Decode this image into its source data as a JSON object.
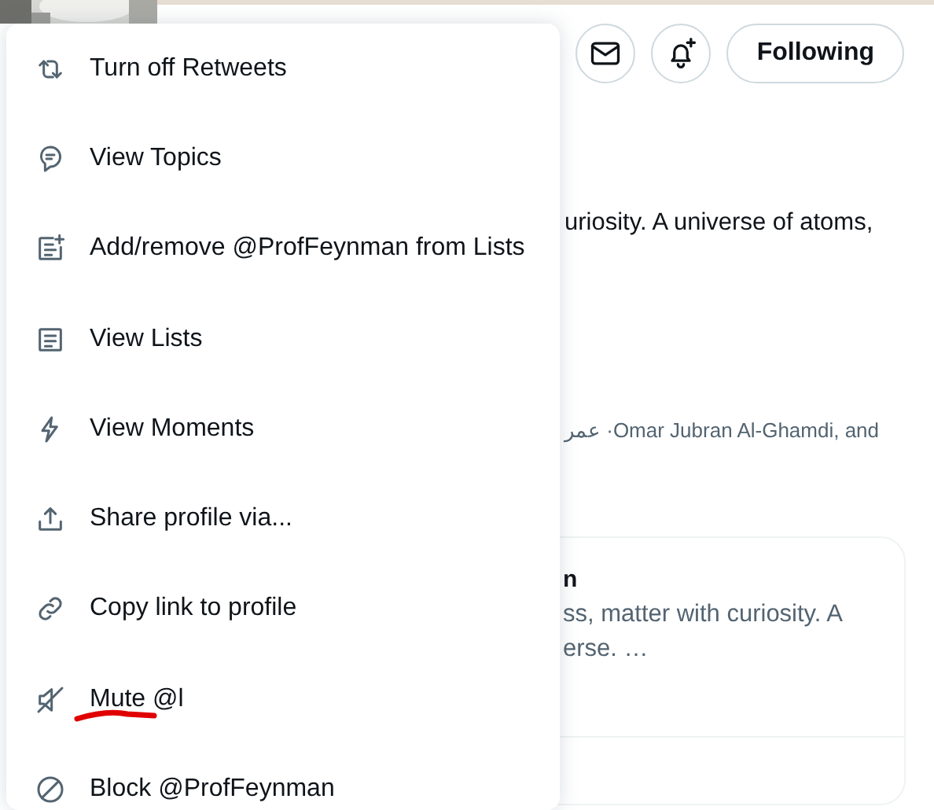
{
  "profile_actions": {
    "buttons": [
      {
        "kind": "message"
      },
      {
        "kind": "notify"
      }
    ],
    "follow_button": "Following"
  },
  "bio_fragment": "uriosity. A universe of atoms,",
  "followers_fragment": "عمر ·Omar Jubran Al-Ghamdi, and",
  "card": {
    "title_fragment": "n",
    "text_lines": [
      "ss, matter with curiosity. A",
      "erse. …"
    ]
  },
  "menu": {
    "items": [
      {
        "label": "Turn off Retweets"
      },
      {
        "label": "View Topics"
      },
      {
        "label": "Add/remove @ProfFeynman from Lists"
      },
      {
        "label": "View Lists"
      },
      {
        "label": "View Moments"
      },
      {
        "label": "Share profile via..."
      },
      {
        "label": "Copy link to profile"
      },
      {
        "label": "Mute @l"
      },
      {
        "label": "Block @ProfFeynman"
      }
    ]
  }
}
